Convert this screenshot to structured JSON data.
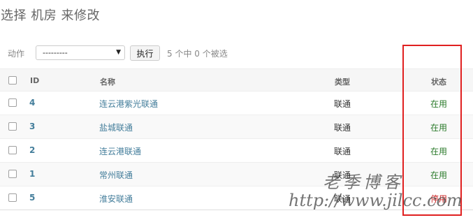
{
  "page": {
    "title": "选择 机房 来修改"
  },
  "actions": {
    "label": "动作",
    "select_value": "---------",
    "go_label": "执行",
    "counter": "5 个中 0 个被选"
  },
  "table": {
    "headers": {
      "id": "ID",
      "name": "名称",
      "type": "类型",
      "status": "状态"
    },
    "rows": [
      {
        "id": "4",
        "name": "连云港紫光联通",
        "type": "联通",
        "status": "在用",
        "status_color": "#2a7a2a"
      },
      {
        "id": "3",
        "name": "盐城联通",
        "type": "联通",
        "status": "在用",
        "status_color": "#2a7a2a"
      },
      {
        "id": "2",
        "name": "连云港联通",
        "type": "联通",
        "status": "在用",
        "status_color": "#2a7a2a"
      },
      {
        "id": "1",
        "name": "常州联通",
        "type": "联通",
        "status": "在用",
        "status_color": "#2a7a2a"
      },
      {
        "id": "5",
        "name": "淮安联通",
        "type": "联通",
        "status": "停用",
        "status_color": "#cc2222"
      }
    ]
  },
  "watermark": {
    "line1": "老季博客",
    "line2": "http://www.jilcc.com"
  },
  "colors": {
    "link": "#447e9b",
    "highlight": "#e02020"
  }
}
